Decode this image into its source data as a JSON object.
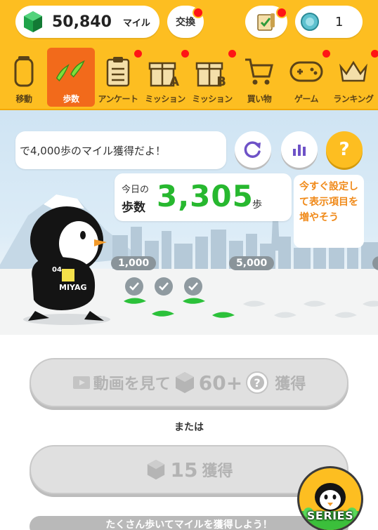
{
  "header": {
    "miles_value": "50,840",
    "miles_unit": "マイル",
    "exchange_label": "交換",
    "ticket_count": "1"
  },
  "nav": {
    "items": [
      {
        "label": "移動",
        "icon": "battery-icon"
      },
      {
        "label": "歩数",
        "icon": "footprints-icon"
      },
      {
        "label": "アンケート",
        "icon": "clipboard-icon"
      },
      {
        "label": "ミッション",
        "icon": "gift-a-icon",
        "letter": "A"
      },
      {
        "label": "ミッション",
        "icon": "gift-b-icon",
        "letter": "B"
      },
      {
        "label": "買い物",
        "icon": "cart-icon"
      },
      {
        "label": "ゲーム",
        "icon": "gamepad-icon"
      },
      {
        "label": "ランキング",
        "icon": "crown-icon"
      }
    ]
  },
  "scene": {
    "bubble_text": "で4,000歩のマイル獲得だよ！",
    "today_label_1": "今日の",
    "today_label_2": "歩数",
    "steps_value": "3,305",
    "steps_unit": "歩",
    "tip_text": "今すぐ設定して表示項目を増やそう",
    "milestone_1": "1,000",
    "milestone_2": "5,000",
    "shirt_number": "04",
    "shirt_name": "MIYAG",
    "question_mark": "?"
  },
  "actions": {
    "video_label": "動画を見て",
    "video_value": "60+",
    "video_suffix": "獲得",
    "or_label": "または",
    "normal_value": "15",
    "normal_suffix": "獲得",
    "bottom_banner": "たくさん歩いてマイルを獲得しよう！",
    "series_label": "SERIES"
  },
  "colors": {
    "header_bg": "#fdbe21",
    "active_tab": "#f26a1b",
    "steps_green": "#27b82f",
    "tip_orange": "#f08a1a",
    "accent_purple": "#6e52c7"
  }
}
